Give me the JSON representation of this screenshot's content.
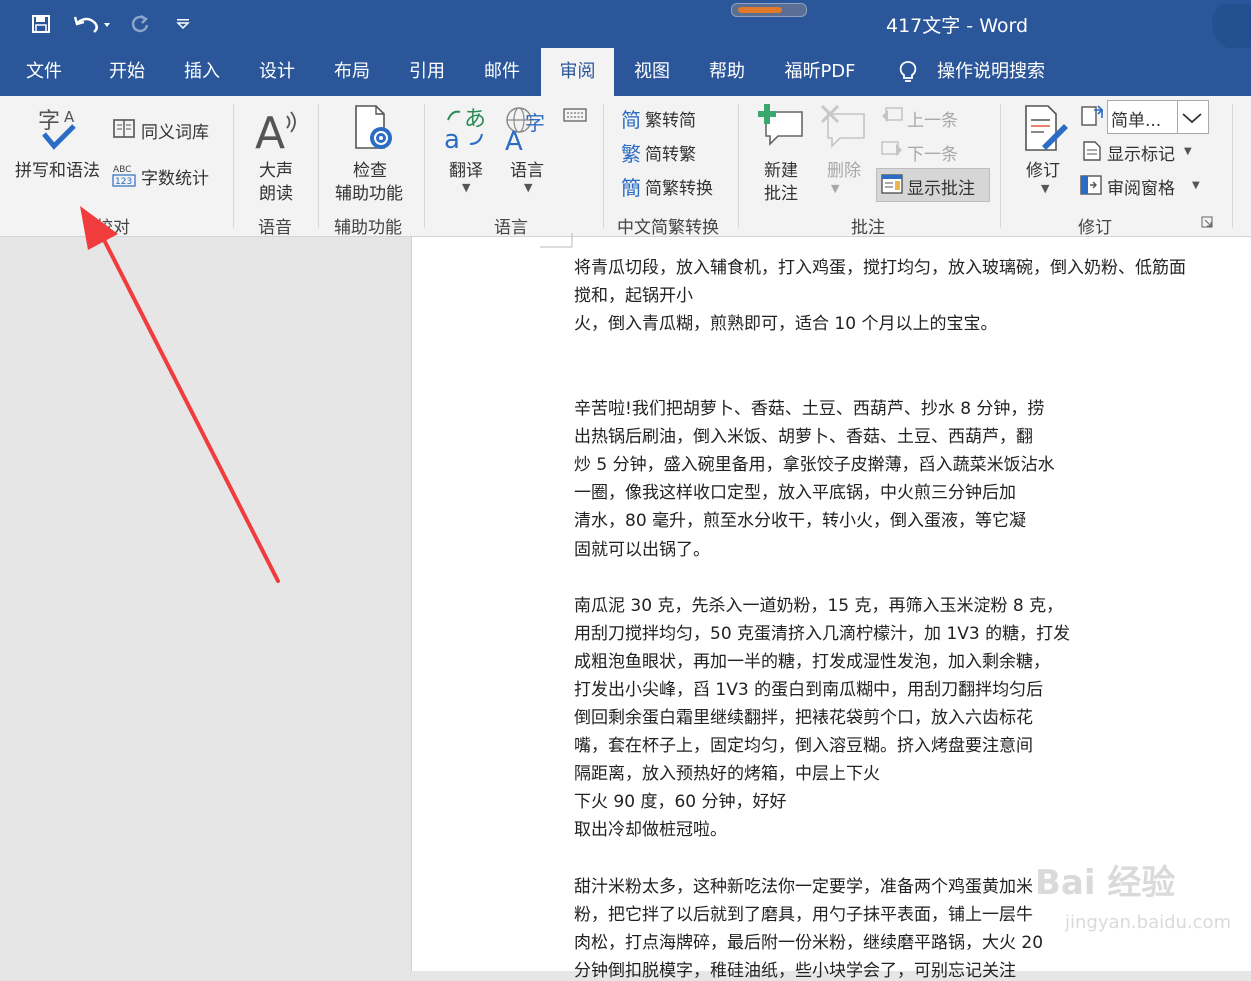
{
  "window": {
    "title": "417文字 - Word",
    "accent": "#2b579a"
  },
  "quick_access": {
    "save": "save-icon",
    "undo": "undo-icon",
    "redo": "redo-icon",
    "customize": "customize-icon"
  },
  "tabs": [
    "文件",
    "开始",
    "插入",
    "设计",
    "布局",
    "引用",
    "邮件",
    "审阅",
    "视图",
    "帮助",
    "福昕PDF",
    "操作说明搜索"
  ],
  "active_tab": "审阅",
  "ribbon": {
    "spelling": "拼写和语法",
    "thesaurus": "同义词库",
    "word_count": "字数统计",
    "read_aloud_1": "大声",
    "read_aloud_2": "朗读",
    "check_access_1": "检查",
    "check_access_2": "辅助功能",
    "translate": "翻译",
    "language": "语言",
    "trad_to_simp": "繁转简",
    "simp_to_trad": "简转繁",
    "convert": "简繁转换",
    "new_comment_1": "新建",
    "new_comment_2": "批注",
    "delete": "删除",
    "prev": "上一条",
    "next": "下一条",
    "show_comments": "显示批注",
    "track_changes": "修订",
    "markup_combo": "简单...",
    "show_markup": "显示标记",
    "review_pane": "审阅窗格",
    "groups": {
      "proofing": "校对",
      "speech": "语音",
      "accessibility": "辅助功能",
      "language": "语言",
      "chinese_conversion": "中文简繁转换",
      "comments": "批注",
      "tracking": "修订"
    }
  },
  "document": {
    "lines": [
      "将青瓜切段，放入辅食机，打入鸡蛋，搅打均匀，放入玻璃碗，倒入奶粉、低筋面",
      "搅和，起锅开小",
      "火，倒入青瓜糊，煎熟即可，适合 10 个月以上的宝宝。",
      "辛苦啦!我们把胡萝卜、香菇、土豆、西葫芦、抄水 8 分钟，捞",
      "出热锅后刷油，倒入米饭、胡萝卜、香菇、土豆、西葫芦，翻",
      "炒 5 分钟，盛入碗里备用，拿张饺子皮擀薄，舀入蔬菜米饭沾水",
      "一圈，像我这样收口定型，放入平底锅，中火煎三分钟后加",
      "清水，80 毫升，煎至水分收干，转小火，倒入蛋液，等它凝",
      "固就可以出锅了。",
      "南瓜泥 30 克，先杀入一道奶粉，15 克，再筛入玉米淀粉 8 克，",
      "用刮刀搅拌均匀，50 克蛋清挤入几滴柠檬汁，加 1V3 的糖，打发",
      "成粗泡鱼眼状，再加一半的糖，打发成湿性发泡，加入剩余糖，",
      "打发出小尖峰，舀 1V3 的蛋白到南瓜糊中，用刮刀翻拌均匀后",
      "倒回剩余蛋白霜里继续翻拌，把裱花袋剪个口，放入六齿标花",
      "嘴，套在杯子上，固定均匀，倒入溶豆糊。挤入烤盘要注意间",
      "隔距离，放入预热好的烤箱，中层上下火",
      "下火 90 度，60 分钟，好好",
      "取出冷却做桩冠啦。",
      "甜汁米粉太多，这种新吃法你一定要学，准备两个鸡蛋黄加米",
      "粉，把它拌了以后就到了磨具，用勺子抹平表面，铺上一层牛",
      "肉松，打点海牌碎，最后附一份米粉，继续磨平路锅，大火 20",
      "分钟倒扣脱模字，稚硅油纸，些小块学会了，可别忘记关注"
    ]
  },
  "watermark": {
    "text": "Bai 经验",
    "url": "jingyan.baidu.com"
  },
  "arrow_color": "#f03c3c"
}
